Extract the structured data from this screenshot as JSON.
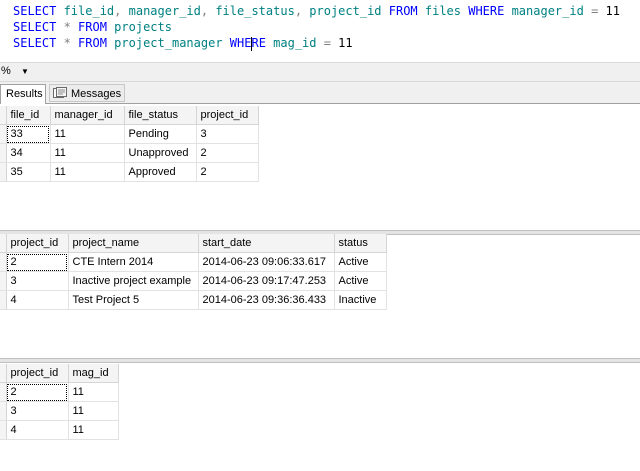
{
  "editor": {
    "lines": [
      [
        {
          "t": "SELECT",
          "c": "kw"
        },
        {
          "t": " file_id",
          "c": "obj"
        },
        {
          "t": ",",
          "c": "op"
        },
        {
          "t": " manager_id",
          "c": "obj"
        },
        {
          "t": ",",
          "c": "op"
        },
        {
          "t": " file_status",
          "c": "obj"
        },
        {
          "t": ",",
          "c": "op"
        },
        {
          "t": " project_id ",
          "c": "obj"
        },
        {
          "t": "FROM",
          "c": "kw"
        },
        {
          "t": " files ",
          "c": "obj"
        },
        {
          "t": "WHERE",
          "c": "kw"
        },
        {
          "t": " manager_id ",
          "c": "obj"
        },
        {
          "t": "=",
          "c": "op"
        },
        {
          "t": " 11",
          "c": ""
        }
      ],
      [
        {
          "t": "SELECT",
          "c": "kw"
        },
        {
          "t": " * ",
          "c": "op"
        },
        {
          "t": "FROM",
          "c": "kw"
        },
        {
          "t": " projects",
          "c": "obj"
        }
      ],
      [
        {
          "t": "SELECT",
          "c": "kw"
        },
        {
          "t": " * ",
          "c": "op"
        },
        {
          "t": "FROM",
          "c": "kw"
        },
        {
          "t": " project_manager ",
          "c": "obj"
        },
        {
          "t": "WHE",
          "c": "kw"
        },
        {
          "t": "|caret|",
          "c": "caret"
        },
        {
          "t": "RE",
          "c": "kw"
        },
        {
          "t": " mag_id ",
          "c": "obj"
        },
        {
          "t": "=",
          "c": "op"
        },
        {
          "t": " 11",
          "c": ""
        }
      ]
    ]
  },
  "zoom": {
    "value": "%",
    "dropdown_icon": "triangle-down-icon"
  },
  "tabs": {
    "results": "Results",
    "messages": "Messages"
  },
  "grids": [
    {
      "columns": [
        "file_id",
        "manager_id",
        "file_status",
        "project_id"
      ],
      "widths": [
        44,
        74,
        72,
        62
      ],
      "rows": [
        [
          "33",
          "11",
          "Pending",
          "3"
        ],
        [
          "34",
          "11",
          "Unapproved",
          "2"
        ],
        [
          "35",
          "11",
          "Approved",
          "2"
        ]
      ]
    },
    {
      "columns": [
        "project_id",
        "project_name",
        "start_date",
        "status"
      ],
      "widths": [
        62,
        130,
        136,
        52
      ],
      "rows": [
        [
          "2",
          "CTE Intern 2014",
          "2014-06-23 09:06:33.617",
          "Active"
        ],
        [
          "3",
          "Inactive project example",
          "2014-06-23 09:17:47.253",
          "Active"
        ],
        [
          "4",
          "Test Project 5",
          "2014-06-23 09:36:36.433",
          "Inactive"
        ]
      ]
    },
    {
      "columns": [
        "project_id",
        "mag_id"
      ],
      "widths": [
        62,
        50
      ],
      "rows": [
        [
          "2",
          "11"
        ],
        [
          "3",
          "11"
        ],
        [
          "4",
          "11"
        ]
      ]
    }
  ]
}
